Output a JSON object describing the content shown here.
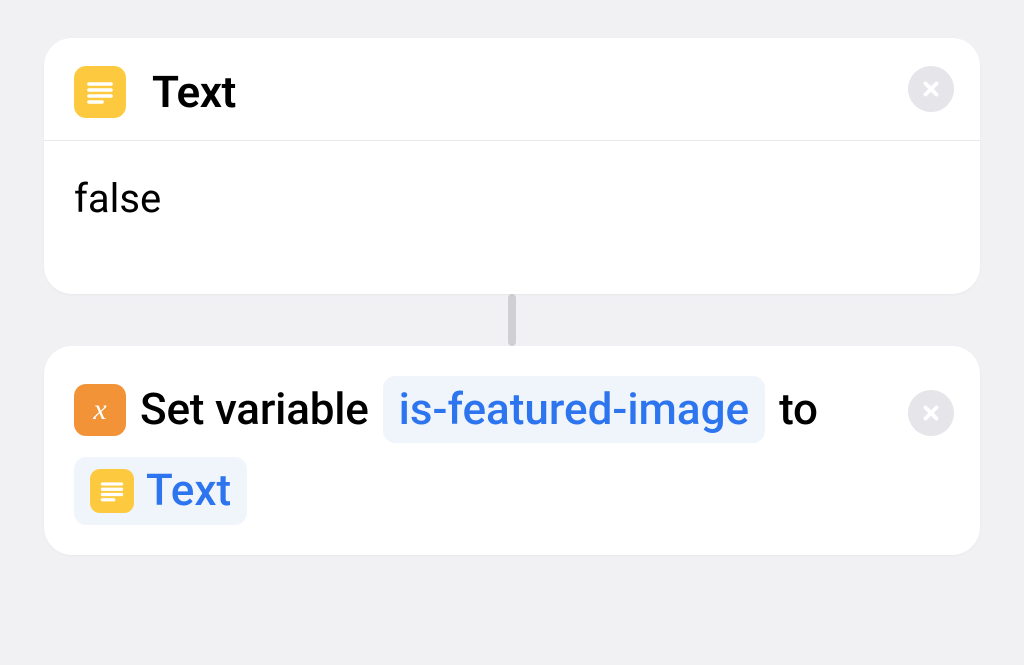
{
  "text_action": {
    "title": "Text",
    "value": "false"
  },
  "set_variable_action": {
    "prefix": "Set variable",
    "variable_name": "is-featured-image",
    "connector_word": "to",
    "input_token_label": "Text"
  }
}
